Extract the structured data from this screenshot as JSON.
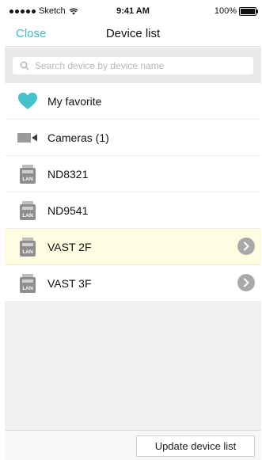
{
  "status_bar": {
    "carrier": "Sketch",
    "time": "9:41 AM",
    "battery": "100%",
    "battery_level": 1.0
  },
  "nav": {
    "close_label": "Close",
    "title": "Device list"
  },
  "search": {
    "placeholder": "Search device by device name",
    "value": ""
  },
  "list": {
    "items": [
      {
        "label": "My favorite",
        "icon": "heart-icon"
      },
      {
        "label": "Cameras (1)",
        "icon": "video-camera-icon"
      },
      {
        "label": "ND8321",
        "icon": "lan-device-icon"
      },
      {
        "label": "ND9541",
        "icon": "lan-device-icon"
      },
      {
        "label": "VAST 2F",
        "icon": "lan-device-icon",
        "highlighted": true,
        "action_icon": "chevron-right-icon"
      },
      {
        "label": "VAST 3F",
        "icon": "lan-device-icon",
        "action_icon": "chevron-right-icon"
      }
    ]
  },
  "footer": {
    "update_label": "Update device list"
  },
  "colors": {
    "accent": "#3bbcc7",
    "highlight_row": "#fffde1",
    "chevron_bg": "#a9a9a9"
  }
}
